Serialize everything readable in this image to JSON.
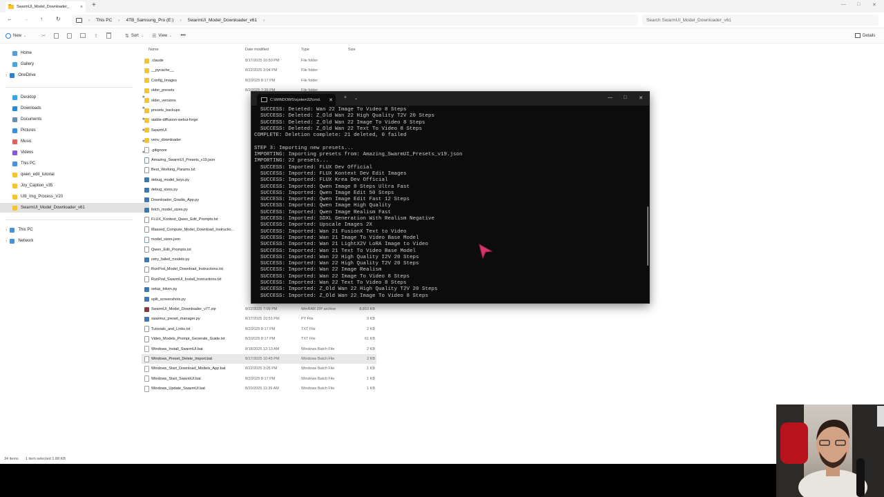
{
  "titlebar": {
    "tab_title": "SwarmUI_Model_Downloader_",
    "new_tab": "+",
    "close": "×"
  },
  "address": {
    "crumbs": [
      "This PC",
      "4TB_Samsung_Pro (E:)",
      "SwarmUI_Model_Downloader_v61"
    ],
    "search_placeholder": "Search SwarmUI_Model_Downloader_v61"
  },
  "toolbar": {
    "new_label": "New",
    "sort_label": "Sort",
    "view_label": "View",
    "more": "•••",
    "details_label": "Details"
  },
  "sidebar": {
    "items": [
      {
        "label": "Home",
        "color": "#5b9bd5"
      },
      {
        "label": "Gallery",
        "color": "#4aa3df"
      },
      {
        "label": "OneDrive",
        "color": "#2d7fd3"
      },
      {
        "label": "Desktop",
        "color": "#3aa0e8"
      },
      {
        "label": "Downloads",
        "color": "#2b8ad6"
      },
      {
        "label": "Documents",
        "color": "#6e8ba8"
      },
      {
        "label": "Pictures",
        "color": "#3c8fd8"
      },
      {
        "label": "Music",
        "color": "#e0605a"
      },
      {
        "label": "Videos",
        "color": "#8a5ad6"
      },
      {
        "label": "This PC",
        "color": "#4a90d9"
      },
      {
        "label": "qwen_edit_tutorial",
        "color": "#f4c430"
      },
      {
        "label": "Joy_Caption_v35",
        "color": "#f4c430"
      },
      {
        "label": "Ulti_Img_Process_V20",
        "color": "#f4c430"
      },
      {
        "label": "SwarmUI_Model_Downloader_v61",
        "color": "#f4c430"
      },
      {
        "label": "This PC",
        "color": "#4a90d9"
      },
      {
        "label": "Network",
        "color": "#4a90d9"
      }
    ]
  },
  "columns": {
    "name": "Name",
    "date": "Date modified",
    "type": "Type",
    "size": "Size"
  },
  "files": [
    {
      "name": ".claude",
      "date": "8/17/2025 10:50 PM",
      "type": "File folder",
      "size": "",
      "kind": "folder"
    },
    {
      "name": "__pycache__",
      "date": "8/22/2025 3:04 PM",
      "type": "File folder",
      "size": "",
      "kind": "folder"
    },
    {
      "name": "Config_Images",
      "date": "8/2/2025 8:17 PM",
      "type": "File folder",
      "size": "",
      "kind": "folder"
    },
    {
      "name": "older_presets",
      "date": "8/2/2025 7:36 PM",
      "type": "File folder",
      "size": "",
      "kind": "folder"
    },
    {
      "name": "older_versions",
      "date": "",
      "type": "",
      "size": "",
      "kind": "folder"
    },
    {
      "name": "presets_backups",
      "date": "",
      "type": "",
      "size": "",
      "kind": "folder"
    },
    {
      "name": "stable-diffusion-webui-forge",
      "date": "",
      "type": "",
      "size": "",
      "kind": "folder"
    },
    {
      "name": "SwarmUI",
      "date": "",
      "type": "",
      "size": "",
      "kind": "folder"
    },
    {
      "name": "venv_downloader",
      "date": "",
      "type": "",
      "size": "",
      "kind": "folder"
    },
    {
      "name": ".gitignore",
      "date": "",
      "type": "",
      "size": "",
      "kind": "file"
    },
    {
      "name": "Amazing_SwarmUI_Presets_v19.json",
      "date": "",
      "type": "",
      "size": "",
      "kind": "json"
    },
    {
      "name": "Best_Working_Params.txt",
      "date": "",
      "type": "",
      "size": "",
      "kind": "txt"
    },
    {
      "name": "debug_model_keys.py",
      "date": "",
      "type": "",
      "size": "",
      "kind": "py"
    },
    {
      "name": "debug_sizes.py",
      "date": "",
      "type": "",
      "size": "",
      "kind": "py"
    },
    {
      "name": "Downloader_Gradio_App.py",
      "date": "",
      "type": "",
      "size": "",
      "kind": "py"
    },
    {
      "name": "fetch_model_sizes.py",
      "date": "",
      "type": "",
      "size": "",
      "kind": "py"
    },
    {
      "name": "FLUX_Kontext_Qwen_Edit_Prompts.txt",
      "date": "",
      "type": "",
      "size": "",
      "kind": "txt"
    },
    {
      "name": "Massed_Compute_Model_Download_Instructio...",
      "date": "",
      "type": "",
      "size": "",
      "kind": "txt"
    },
    {
      "name": "model_sizes.json",
      "date": "",
      "type": "",
      "size": "",
      "kind": "json"
    },
    {
      "name": "Qwen_Edit_Prompts.txt",
      "date": "",
      "type": "",
      "size": "",
      "kind": "txt"
    },
    {
      "name": "retry_failed_models.py",
      "date": "",
      "type": "",
      "size": "",
      "kind": "py"
    },
    {
      "name": "RunPod_Model_Download_Instructions.txt",
      "date": "",
      "type": "",
      "size": "",
      "kind": "txt"
    },
    {
      "name": "RunPod_SwarmUI_Install_Instructions.txt",
      "date": "",
      "type": "",
      "size": "",
      "kind": "txt"
    },
    {
      "name": "setup_token.py",
      "date": "",
      "type": "",
      "size": "",
      "kind": "py"
    },
    {
      "name": "split_screenshots.py",
      "date": "",
      "type": "",
      "size": "",
      "kind": "py"
    },
    {
      "name": "SwarmUI_Model_Downloader_v77.zip",
      "date": "8/22/2025 7:09 PM",
      "type": "WinRAR ZIP archive",
      "size": "8,810 KB",
      "kind": "zip"
    },
    {
      "name": "swarmui_preset_manager.py",
      "date": "8/17/2025 10:51 PM",
      "type": "PY File",
      "size": "9 KB",
      "kind": "py"
    },
    {
      "name": "Tutorials_and_Links.txt",
      "date": "8/2/2025 8:17 PM",
      "type": "TXT File",
      "size": "2 KB",
      "kind": "txt"
    },
    {
      "name": "Video_Models_Prompt_Generate_Guide.txt",
      "date": "8/2/2025 8:17 PM",
      "type": "TXT File",
      "size": "61 KB",
      "kind": "txt"
    },
    {
      "name": "Windows_Install_SwarmUI.bat",
      "date": "8/18/2025 12:13 AM",
      "type": "Windows Batch File",
      "size": "2 KB",
      "kind": "bat"
    },
    {
      "name": "Windows_Preset_Delete_Import.bat",
      "date": "8/17/2025 10:45 PM",
      "type": "Windows Batch File",
      "size": "2 KB",
      "kind": "bat",
      "selected": true
    },
    {
      "name": "Windows_Start_Download_Models_App.bat",
      "date": "8/22/2025 3:05 PM",
      "type": "Windows Batch File",
      "size": "1 KB",
      "kind": "bat"
    },
    {
      "name": "Windows_Start_SwarmUI.bat",
      "date": "8/2/2025 8:17 PM",
      "type": "Windows Batch File",
      "size": "1 KB",
      "kind": "bat"
    },
    {
      "name": "Windows_Update_SwarmUI.bat",
      "date": "8/20/2025 11:39 AM",
      "type": "Windows Batch File",
      "size": "1 KB",
      "kind": "bat"
    }
  ],
  "status": {
    "count": "34 items",
    "selected": "1 item selected  1.88 KB"
  },
  "cmd": {
    "tab_title": "C:\\WINDOWS\\system32\\cmd.",
    "lines": [
      "  SUCCESS: Deleted: Wan 22 Image To Video 8 Steps",
      "  SUCCESS: Deleted: Z_Old Wan 22 High Quality T2V 20 Steps",
      "  SUCCESS: Deleted: Z_Old Wan 22 Image To Video 8 Steps",
      "  SUCCESS: Deleted: Z_Old Wan 22 Text To Video 8 Steps",
      "COMPLETE: Deletion complete: 21 deleted, 0 failed",
      "",
      "STEP 3: Importing new presets...",
      "IMPORTING: Importing presets from: Amazing_SwarmUI_Presets_v19.json",
      "IMPORTING: 22 presets...",
      "  SUCCESS: Imported: FLUX Dev Official",
      "  SUCCESS: Imported: FLUX Kontext Dev Edit Images",
      "  SUCCESS: Imported: FLUX Krea Dev Official",
      "  SUCCESS: Imported: Qwen Image 8 Steps Ultra Fast",
      "  SUCCESS: Imported: Qwen Image Edit 50 Steps",
      "  SUCCESS: Imported: Qwen Image Edit Fast 12 Steps",
      "  SUCCESS: Imported: Qwen Image High Quality",
      "  SUCCESS: Imported: Qwen Image Realism Fast",
      "  SUCCESS: Imported: SDXL Generation With Realism Negative",
      "  SUCCESS: Imported: Upscale Images 2X",
      "  SUCCESS: Imported: Wan 21 FusionX Text to Video",
      "  SUCCESS: Imported: Wan 21 Image To Video Base Model",
      "  SUCCESS: Imported: Wan 21 LightX2V LoRA Image to Video",
      "  SUCCESS: Imported: Wan 21 Text To Video Base Model",
      "  SUCCESS: Imported: Wan 22 High Quality I2V 20 Steps",
      "  SUCCESS: Imported: Wan 22 High Quality T2V 20 Steps",
      "  SUCCESS: Imported: Wan 22 Image Realism",
      "  SUCCESS: Imported: Wan 22 Image To Video 8 Steps",
      "  SUCCESS: Imported: Wan 22 Text To Video 8 Steps",
      "  SUCCESS: Imported: Z_Old Wan 22 High Quality T2V 20 Steps",
      "  SUCCESS: Imported: Z_Old Wan 22 Image To Video 8 Steps"
    ]
  },
  "colors": {
    "folder": "#f4c430",
    "cursor": "#d6336c"
  }
}
